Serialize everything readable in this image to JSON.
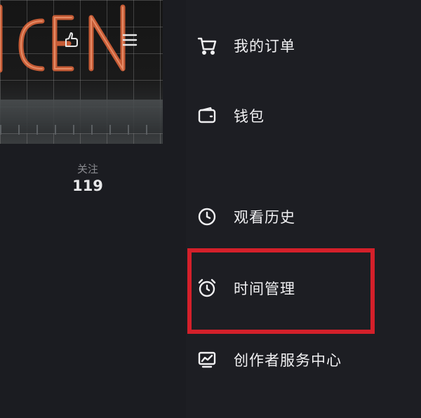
{
  "profile": {
    "follow_label": "关注",
    "follow_count": "119"
  },
  "drawer": {
    "items": [
      {
        "label": "我的订单",
        "icon": "cart-icon"
      },
      {
        "label": "钱包",
        "icon": "wallet-icon"
      },
      {
        "label": "观看历史",
        "icon": "clock-icon"
      },
      {
        "label": "时间管理",
        "icon": "alarm-clock-icon"
      },
      {
        "label": "创作者服务中心",
        "icon": "creator-chart-icon"
      }
    ]
  },
  "colors": {
    "highlight": "#d4202a",
    "neon": "#d9643a",
    "background": "#1d1e23"
  }
}
